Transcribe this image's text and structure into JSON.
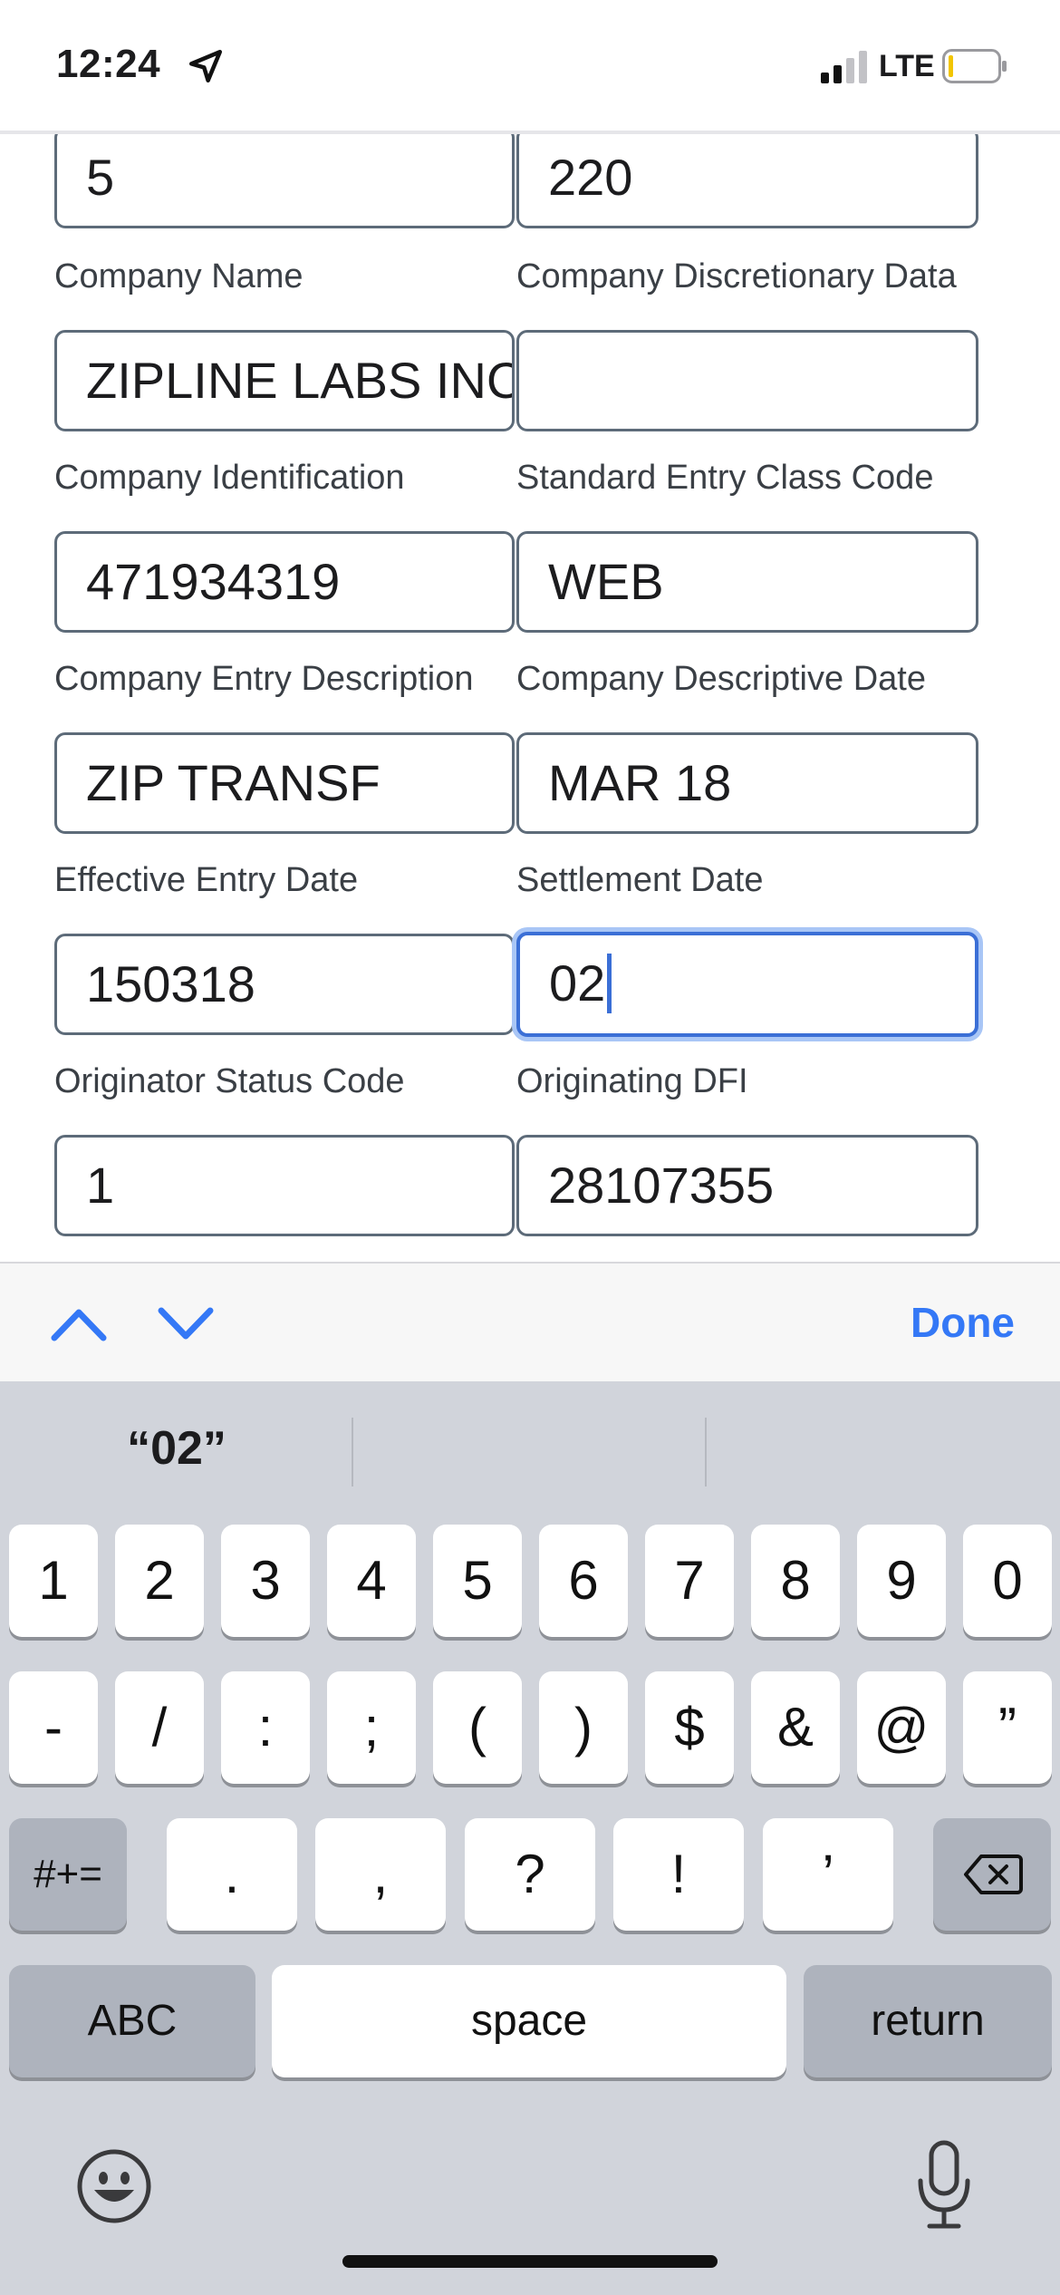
{
  "status_bar": {
    "time": "12:24",
    "carrier": "LTE"
  },
  "form": {
    "row0": {
      "left_value": "5",
      "right_value": "220"
    },
    "fields": [
      {
        "label_left": "Company Name",
        "label_right": "Company Discretionary Data",
        "value_left": "ZIPLINE LABS INC",
        "value_right": ""
      },
      {
        "label_left": "Company Identification",
        "label_right": "Standard Entry Class Code",
        "value_left": "471934319",
        "value_right": "WEB"
      },
      {
        "label_left": "Company Entry Description",
        "label_right": "Company Descriptive Date",
        "value_left": "ZIP TRANSF",
        "value_right": "MAR 18"
      },
      {
        "label_left": "Effective Entry Date",
        "label_right": "Settlement Date",
        "value_left": "150318",
        "value_right": "02"
      },
      {
        "label_left": "Originator Status Code",
        "label_right": "Originating DFI",
        "value_left": "1",
        "value_right": "28107355"
      }
    ]
  },
  "accessory": {
    "done_label": "Done"
  },
  "keyboard": {
    "suggestion": "“02”",
    "row1": [
      "1",
      "2",
      "3",
      "4",
      "5",
      "6",
      "7",
      "8",
      "9",
      "0"
    ],
    "row2": [
      "-",
      "/",
      ":",
      ";",
      "(",
      ")",
      "$",
      "&",
      "@",
      "”"
    ],
    "row3": {
      "symbols_toggle": "#+=",
      "keys": [
        ".",
        ",",
        "?",
        "!",
        "’"
      ]
    },
    "row4": {
      "abc": "ABC",
      "space": "space",
      "return": "return"
    }
  },
  "colors": {
    "accent": "#3478f6",
    "focus_ring": "#3b6fd6",
    "keyboard_bg": "#d1d4db"
  }
}
